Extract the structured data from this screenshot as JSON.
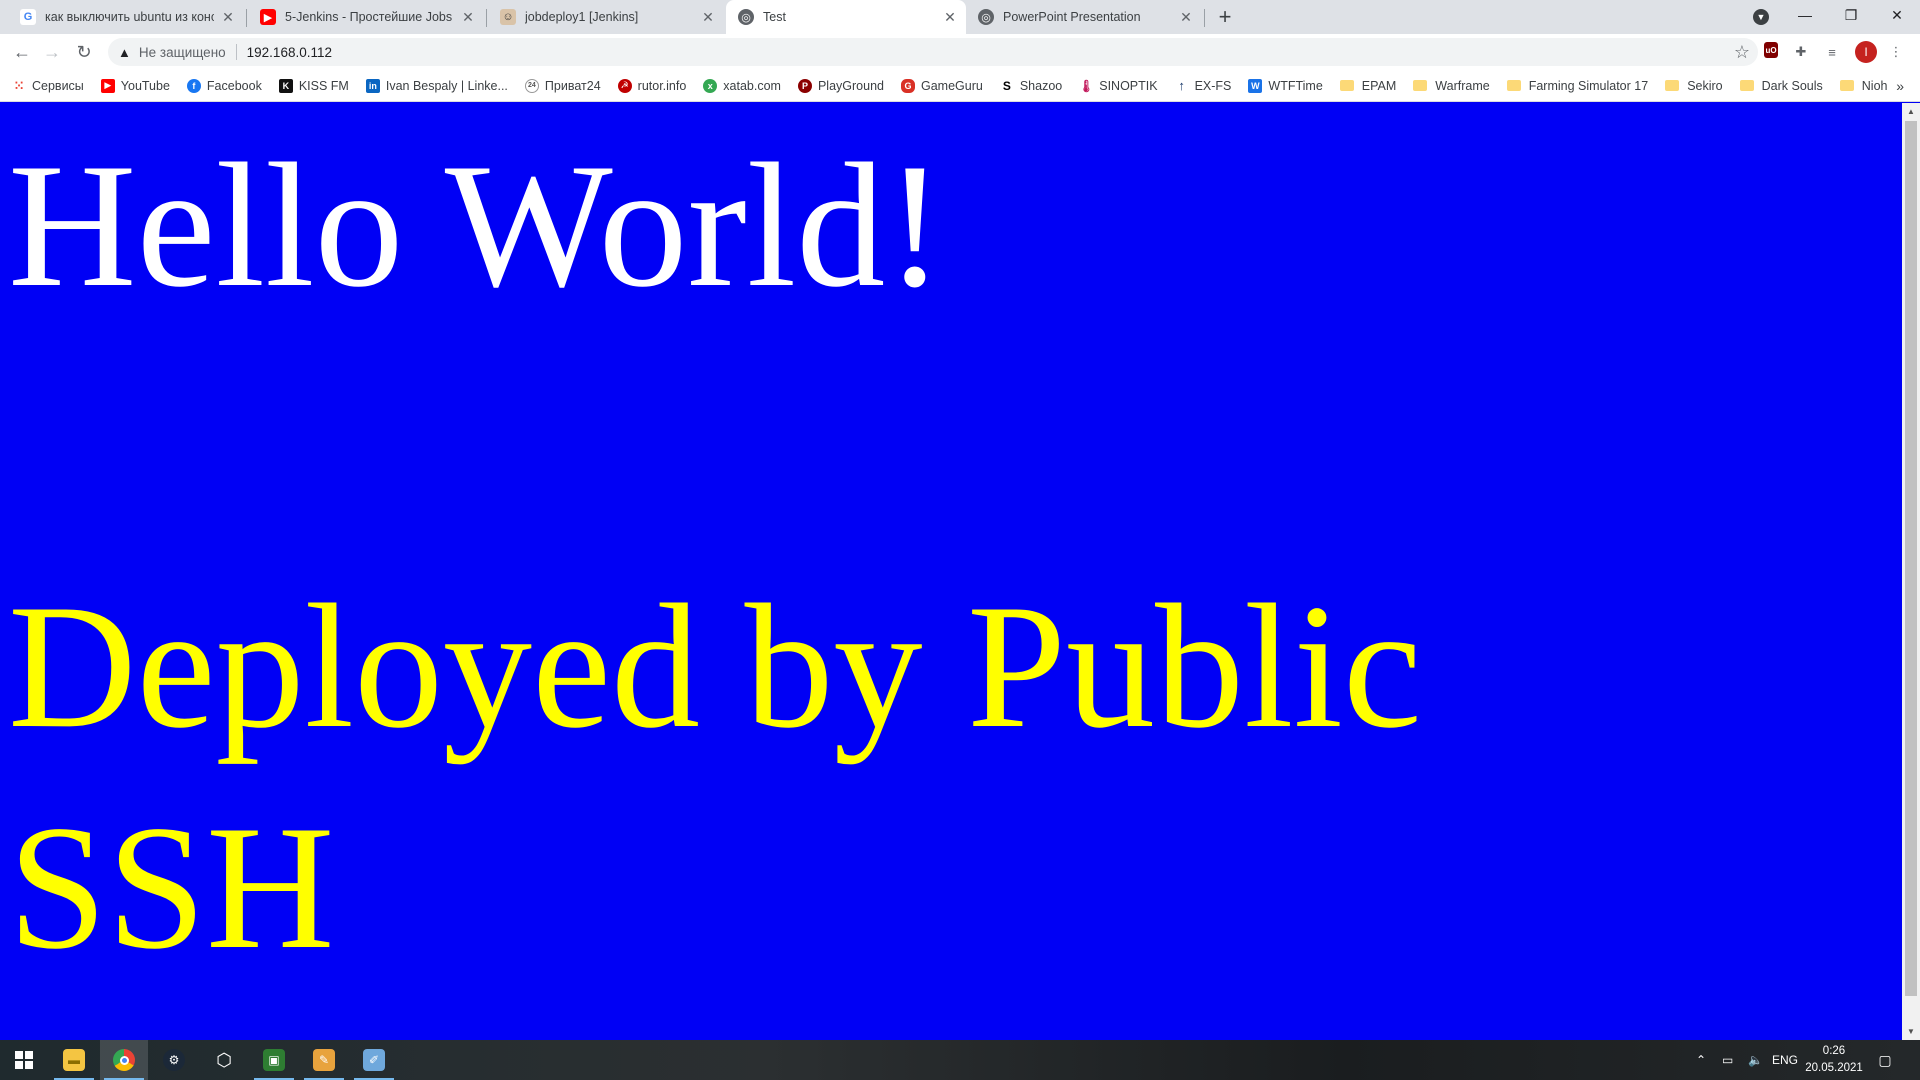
{
  "tabs": [
    {
      "title": "как выключить ubuntu из конс",
      "favicon": "google-icon",
      "color": "#4285f4"
    },
    {
      "title": "5-Jenkins - Простейшие Jobs в",
      "favicon": "youtube-icon",
      "color": "#ff0000"
    },
    {
      "title": "jobdeploy1 [Jenkins]",
      "favicon": "jenkins-icon",
      "color": "#d24939"
    },
    {
      "title": "Test",
      "favicon": "globe-icon",
      "color": "#5f6368"
    },
    {
      "title": "PowerPoint Presentation",
      "favicon": "globe-icon",
      "color": "#5f6368"
    }
  ],
  "toolbar": {
    "security_label": "Не защищено",
    "url": "192.168.0.112",
    "profile_initial": "I"
  },
  "bookmarks": [
    {
      "label": "Сервисы",
      "icon": "apps-grid-icon"
    },
    {
      "label": "YouTube",
      "icon": "youtube-icon"
    },
    {
      "label": "Facebook",
      "icon": "facebook-icon"
    },
    {
      "label": "KISS FM",
      "icon": "kissfm-icon"
    },
    {
      "label": "Ivan Bespaly | Linke...",
      "icon": "linkedin-icon"
    },
    {
      "label": "Приват24",
      "icon": "privat24-icon"
    },
    {
      "label": "rutor.info",
      "icon": "rutor-icon"
    },
    {
      "label": "xatab.com",
      "icon": "xatab-icon"
    },
    {
      "label": "PlayGround",
      "icon": "playground-icon"
    },
    {
      "label": "GameGuru",
      "icon": "gameguru-icon"
    },
    {
      "label": "Shazoo",
      "icon": "shazoo-icon"
    },
    {
      "label": "SINOPTIK",
      "icon": "sinoptik-icon"
    },
    {
      "label": "EX-FS",
      "icon": "exfs-icon"
    },
    {
      "label": "WTFTime",
      "icon": "wtftime-icon"
    },
    {
      "label": "EPAM",
      "icon": "folder-icon"
    },
    {
      "label": "Warframe",
      "icon": "folder-icon"
    },
    {
      "label": "Farming Simulator 17",
      "icon": "folder-icon"
    },
    {
      "label": "Sekiro",
      "icon": "folder-icon"
    },
    {
      "label": "Dark Souls",
      "icon": "folder-icon"
    },
    {
      "label": "Nioh",
      "icon": "folder-icon"
    }
  ],
  "page": {
    "heading1": "Hello World!",
    "heading2": "Deployed by Public SSH",
    "background": "#0000f5",
    "heading1_color": "#ffffff",
    "heading2_color": "#ffff00"
  },
  "taskbar": {
    "language": "ENG",
    "time": "0:26",
    "date": "20.05.2021"
  }
}
